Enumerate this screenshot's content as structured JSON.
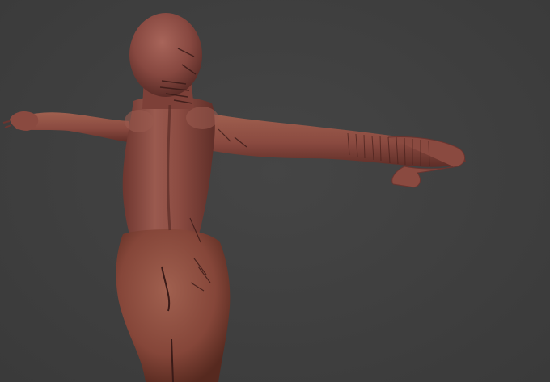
{
  "viewport": {
    "background_color": "#3e3e3e",
    "subject": "sculpted-figure-back-view"
  },
  "model": {
    "material_color": "#8a4a40",
    "highlight_color": "#a8655a",
    "shadow_color": "#5a2c27",
    "detail_color": "#3a1b18"
  }
}
